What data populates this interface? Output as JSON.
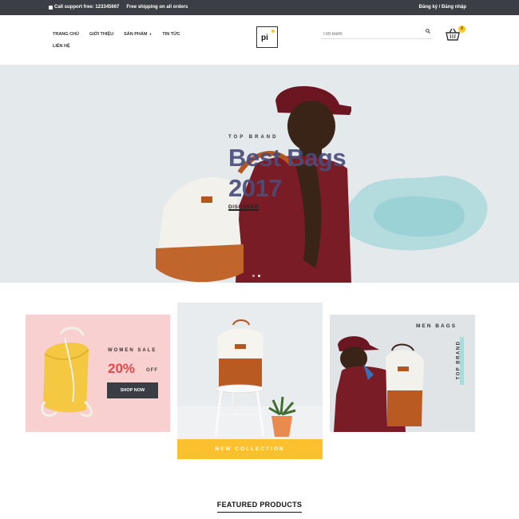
{
  "topbar": {
    "phone_text": "Call support free: 123345667",
    "shipping_text": "Free shipping on all orders",
    "auth_text": "Đăng ký / Đăng nhập"
  },
  "nav": {
    "items": [
      {
        "label": "TRANG CHỦ"
      },
      {
        "label": "GIỚI THIỆU"
      },
      {
        "label": "SẢN PHẨM"
      },
      {
        "label": "TIN TỨC"
      },
      {
        "label": "LIÊN HỆ"
      }
    ]
  },
  "logo": {
    "text": "pi"
  },
  "search": {
    "placeholder": "Tìm kiếm"
  },
  "cart": {
    "count": "0"
  },
  "hero": {
    "eyebrow": "TOP BRAND",
    "title_line1": "Best Bags",
    "title_line2": "2017",
    "cta": "DISCOVER"
  },
  "banners": {
    "women": {
      "label": "WOMEN SALE",
      "percent": "20%",
      "off": "OFF",
      "button": "SHOP NOW"
    },
    "collection": {
      "label": "NEW COLLECTION"
    },
    "men": {
      "label": "MEN BAGS",
      "brand": "TOP BRAND"
    }
  },
  "featured": {
    "title": "FEATURED PRODUCTS"
  },
  "colors": {
    "topbar": "#3b3e44",
    "accent_yellow": "#ffc629",
    "sale_red": "#e4484b",
    "hero_title": "#4a4d7a"
  }
}
